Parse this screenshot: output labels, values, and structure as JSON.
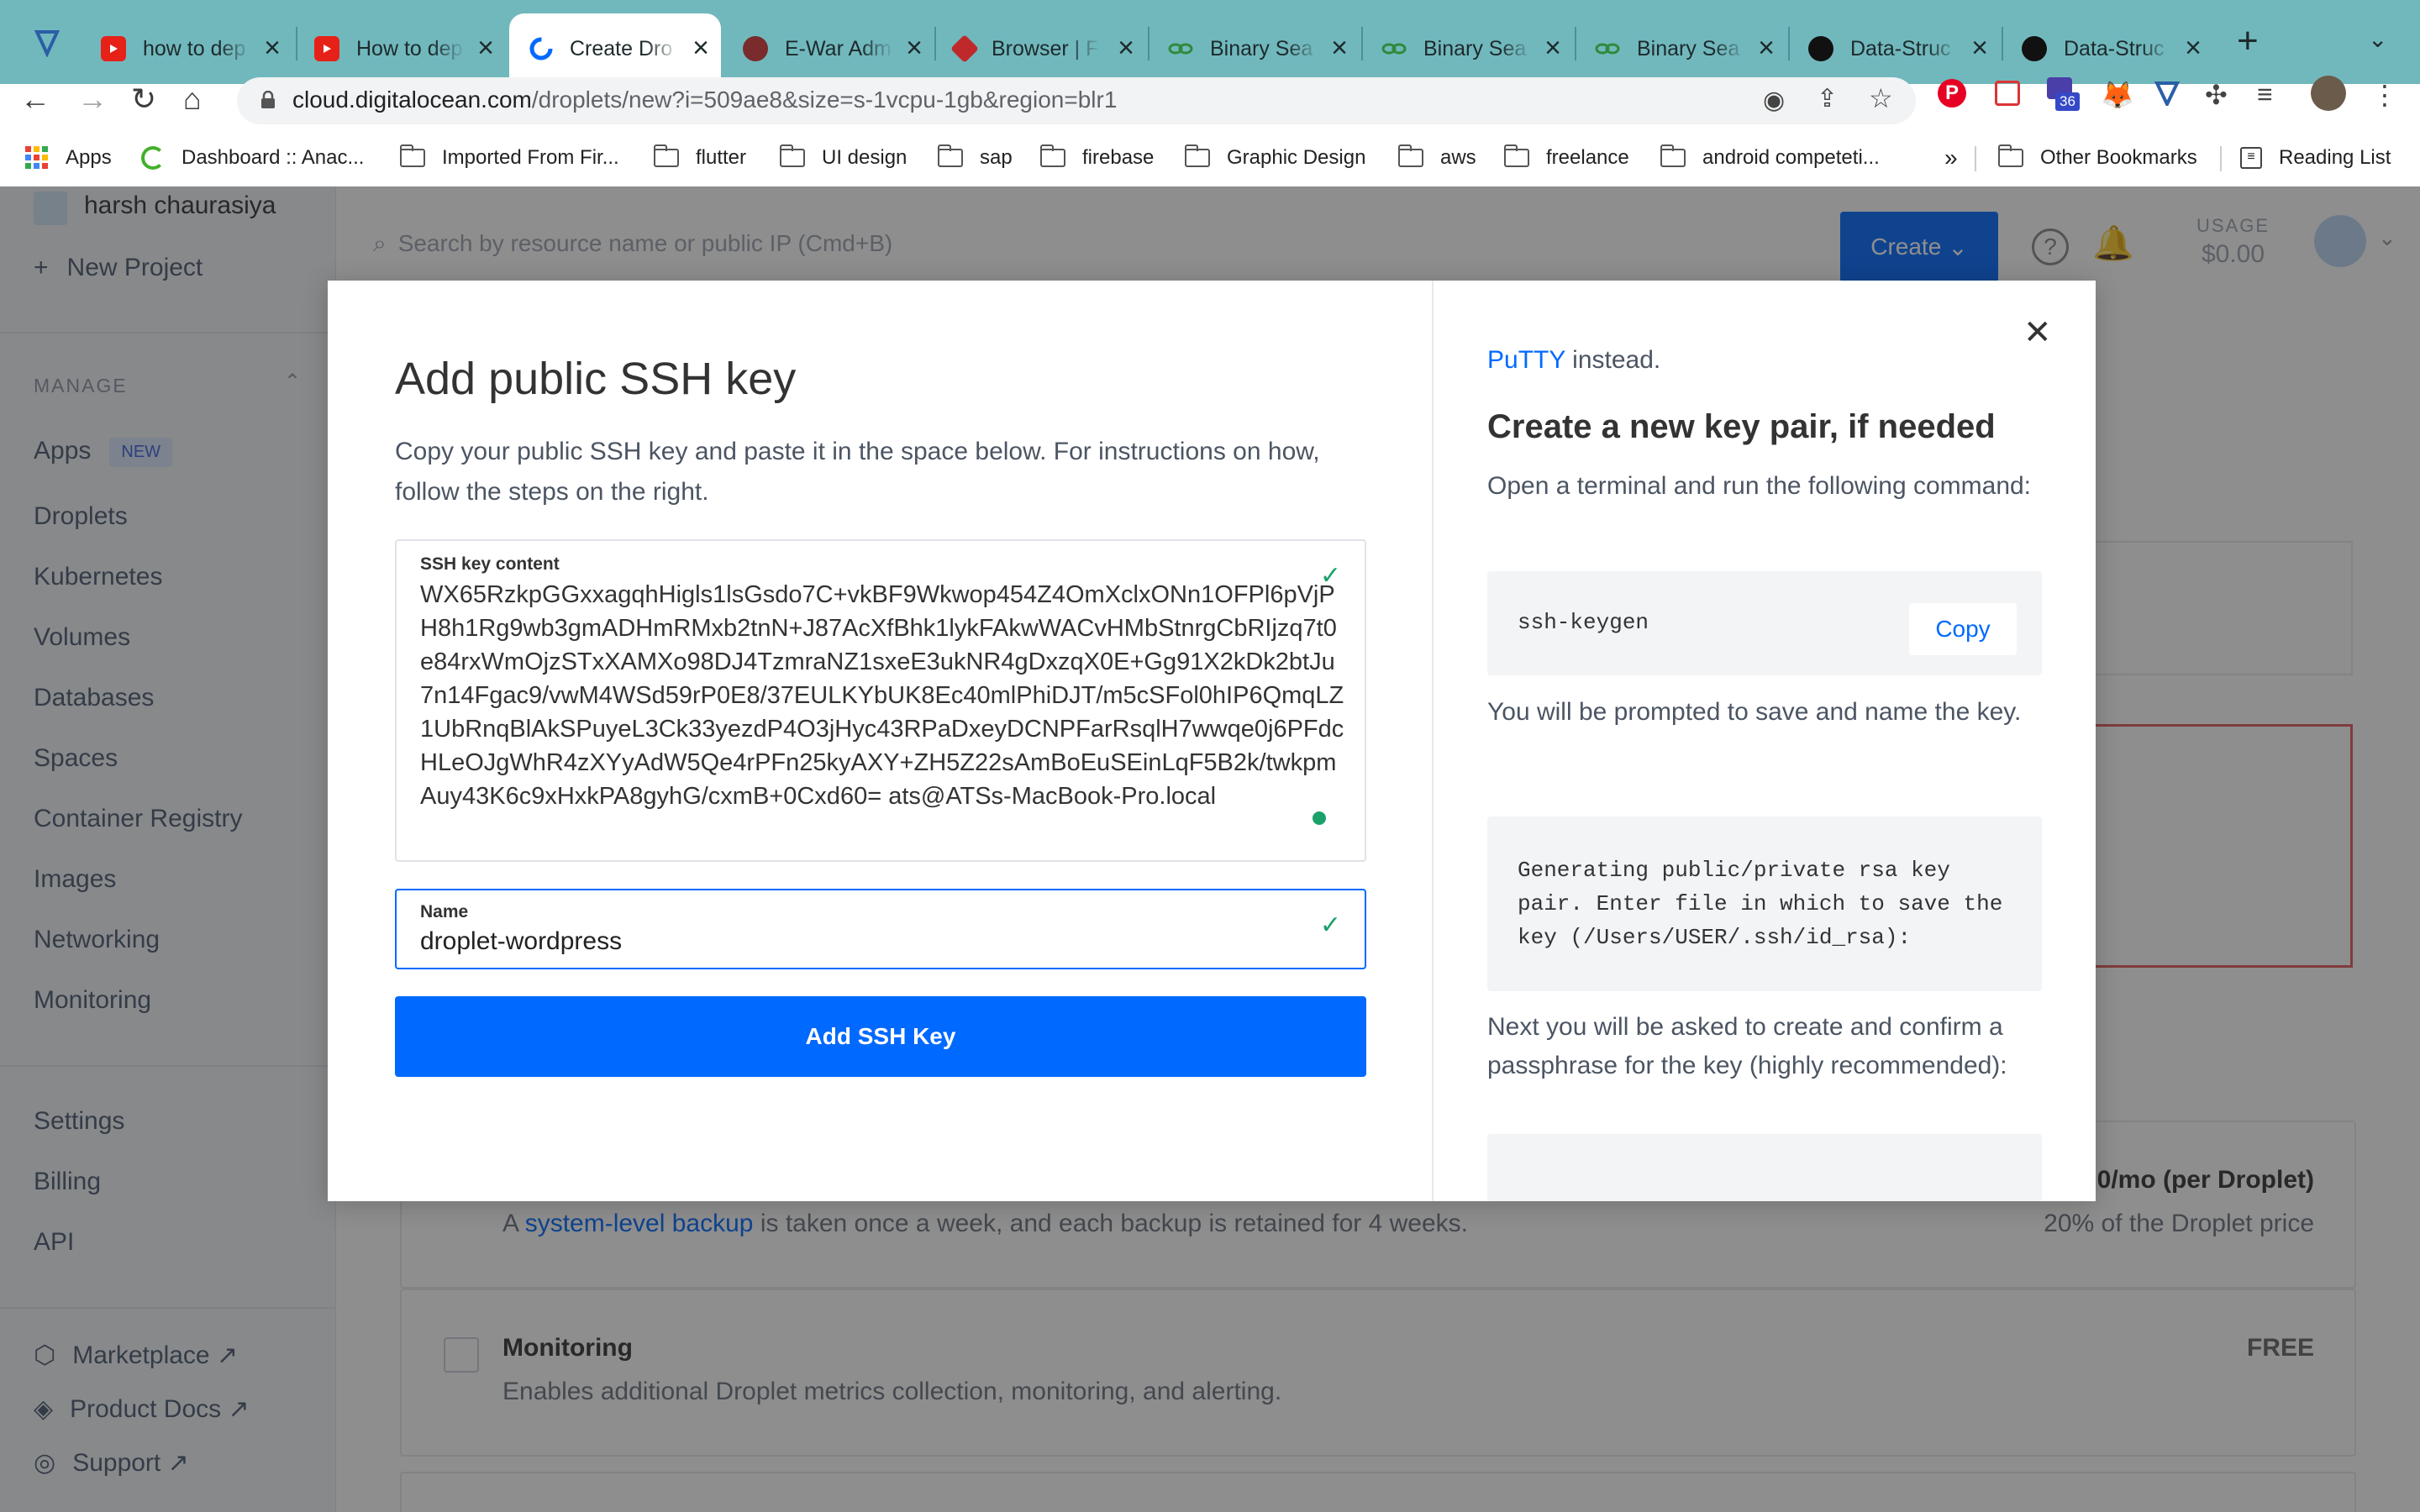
{
  "browser": {
    "tabs": [
      {
        "title": "how to dep",
        "icon": "youtube-icon"
      },
      {
        "title": "How to dep",
        "icon": "youtube-icon"
      },
      {
        "title": "Create Dro",
        "icon": "digitalocean-icon"
      },
      {
        "title": "E-War Adm",
        "icon": "site-icon"
      },
      {
        "title": "Browser | F",
        "icon": "site-icon"
      },
      {
        "title": "Binary Sea",
        "icon": "site-icon"
      },
      {
        "title": "Binary Sea",
        "icon": "site-icon"
      },
      {
        "title": "Binary Sea",
        "icon": "site-icon"
      },
      {
        "title": "Data-Struc",
        "icon": "github-icon"
      },
      {
        "title": "Data-Struc",
        "icon": "github-icon"
      }
    ],
    "url_host": "cloud.digitalocean.com",
    "url_path": "/droplets/new?i=509ae8&size=s-1vcpu-1gb&region=blr1",
    "extension_badge": "36",
    "bookmarks": [
      "Apps",
      "Dashboard :: Anac...",
      "Imported From Fir...",
      "flutter",
      "UI design",
      "sap",
      "firebase",
      "Graphic Design",
      "aws",
      "freelance",
      "android competeti..."
    ],
    "bookmarks_overflow": "»",
    "other_bookmarks": "Other Bookmarks",
    "reading_list": "Reading List"
  },
  "sidebar": {
    "user_name": "harsh chaurasiya",
    "new_project": "New Project",
    "manage_label": "MANAGE",
    "items": [
      "Apps",
      "Droplets",
      "Kubernetes",
      "Volumes",
      "Databases",
      "Spaces",
      "Container Registry",
      "Images",
      "Networking",
      "Monitoring"
    ],
    "new_badge": "NEW",
    "account_items": [
      "Settings",
      "Billing",
      "API"
    ],
    "links": [
      "Marketplace ↗",
      "Product Docs ↗",
      "Support ↗"
    ]
  },
  "header": {
    "search_placeholder": "Search by resource name or public IP (Cmd+B)",
    "create_label": "Create",
    "usage_label": "USAGE",
    "usage_value": "$0.00"
  },
  "background": {
    "backup_text_pre": "A ",
    "backup_link": "system-level backup",
    "backup_text_post": " is taken once a week, and each backup is retained for 4 weeks.",
    "backup_price": "0/mo (per Droplet)",
    "backup_price_sub": "20% of the Droplet price",
    "monitoring_title": "Monitoring",
    "monitoring_desc": "Enables additional Droplet metrics collection, monitoring, and alerting.",
    "monitoring_price": "FREE"
  },
  "modal": {
    "title": "Add public SSH key",
    "description": "Copy your public SSH key and paste it in the space below. For instructions on how, follow the steps on the right.",
    "ssh_label": "SSH key content",
    "ssh_value": "WX65RzkpGGxxagqhHigls1lsGsdo7C+vkBF9Wkwop454Z4OmXclxONn1OFPl6pVjPH8h1Rg9wb3gmADHmRMxb2tnN+J87AcXfBhk1lykFAkwWACvHMbStnrgCbRIjzq7t0e84rxWmOjzSTxXAMXo98DJ4TzmraNZ1sxeE3ukNR4gDxzqX0E+Gg91X2kDk2btJu7n14Fgac9/vwM4WSd59rP0E8/37EULKYbUK8Ec40mlPhiDJT/m5cSFol0hIP6QmqLZ1UbRnqBlAkSPuyeL3Ck33yezdP4O3jHyc43RPaDxeyDCNPFarRsqlH7wwqe0j6PFdcHLeOJgWhR4zXYyAdW5Qe4rPFn25kyAXY+ZH5Z22sAmBoEuSEinLqF5B2k/twkpmAuy43K6c9xHxkPA8gyhG/cxmB+0Cxd60= ats@ATSs-MacBook-Pro.local",
    "name_label": "Name",
    "name_value": "droplet-wordpress",
    "submit_label": "Add SSH Key",
    "right": {
      "putty_link": "PuTTY",
      "putty_rest": " instead.",
      "heading": "Create a new key pair, if needed",
      "step1": "Open a terminal and run the following command:",
      "command": "ssh-keygen",
      "copy_label": "Copy",
      "step2": "You will be prompted to save and name the key.",
      "output": "Generating public/private rsa key pair. Enter file in which to save the key (/Users/USER/.ssh/id_rsa):",
      "step3": "Next you will be asked to create and confirm a passphrase for the key (highly recommended):"
    }
  }
}
